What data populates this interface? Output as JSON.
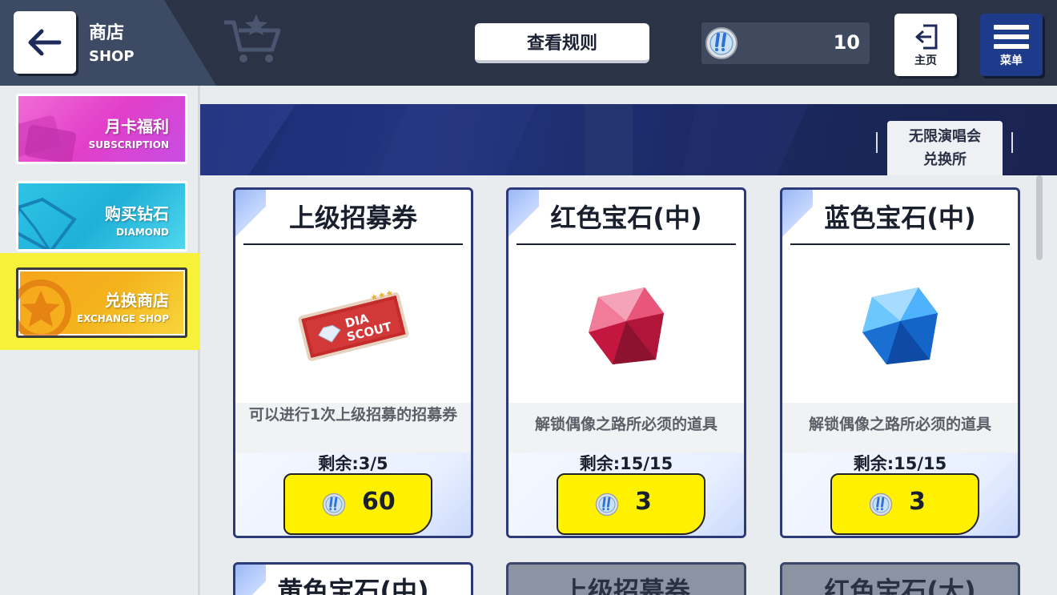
{
  "header": {
    "back_label": "返回",
    "title": "商店",
    "subtitle": "SHOP",
    "rules_label": "查看规则",
    "currency_amount": "10",
    "home_label": "主页",
    "menu_label": "菜单"
  },
  "sidebar": {
    "items": [
      {
        "title": "月卡福利",
        "subtitle": "SUBSCRIPTION"
      },
      {
        "title": "购买钻石",
        "subtitle": "DIAMOND"
      },
      {
        "title": "兑换商店",
        "subtitle": "EXCHANGE SHOP",
        "selected": true
      }
    ]
  },
  "tabs": {
    "active_line1": "无限演唱会",
    "active_line2": "兑换所"
  },
  "items": [
    {
      "name": "上级招募券",
      "desc": "可以进行1次上级招募的招募券",
      "remain": "剩余:3/5",
      "price": "60",
      "ticket_text1": "DIA",
      "ticket_text2": "SCOUT"
    },
    {
      "name": "红色宝石(中)",
      "desc": "解锁偶像之路所必须的道具",
      "remain": "剩余:15/15",
      "price": "3"
    },
    {
      "name": "蓝色宝石(中)",
      "desc": "解锁偶像之路所必须的道具",
      "remain": "剩余:15/15",
      "price": "3"
    }
  ],
  "next_items": [
    {
      "name": "黄色宝石(中)"
    },
    {
      "name": "上级招募券"
    },
    {
      "name": "红色宝石(大)"
    }
  ],
  "colors": {
    "topbar": "#2b3447",
    "price_button": "#fff100",
    "card_border": "#2c3a7a",
    "selected_highlight": "#f7f13a"
  }
}
